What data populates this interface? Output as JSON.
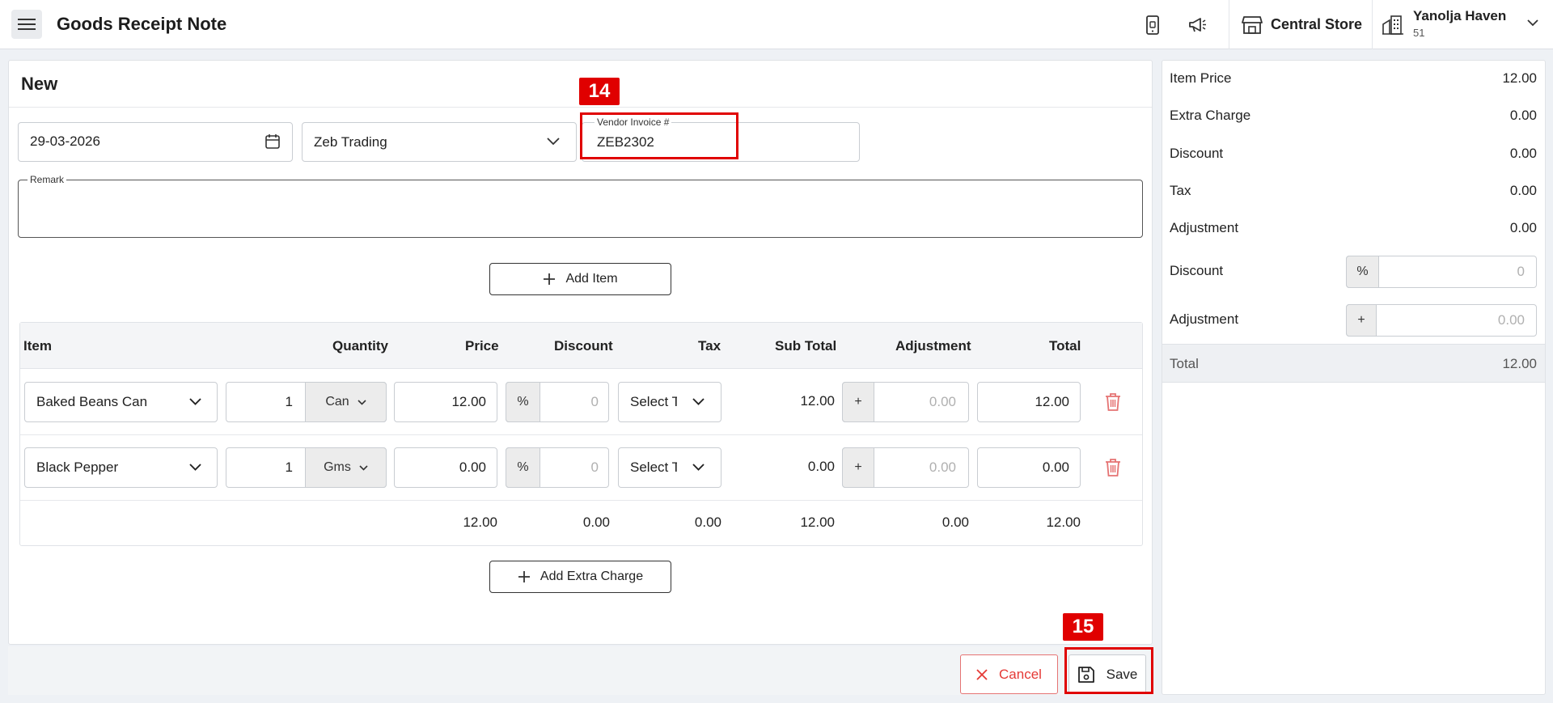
{
  "header": {
    "title": "Goods Receipt Note",
    "store_name": "Central Store",
    "property_name": "Yanolja Haven",
    "property_id": "51"
  },
  "form": {
    "card_title": "New",
    "date_value": "29-03-2026",
    "vendor_value": "Zeb Trading",
    "vendor_invoice_label": "Vendor Invoice #",
    "vendor_invoice_value": "ZEB2302",
    "remark_label": "Remark",
    "remark_value": "",
    "add_item_label": "Add Item",
    "add_extra_charge_label": "Add Extra Charge"
  },
  "table": {
    "headers": {
      "item": "Item",
      "quantity": "Quantity",
      "price": "Price",
      "discount": "Discount",
      "tax": "Tax",
      "subtotal": "Sub Total",
      "adjustment": "Adjustment",
      "total": "Total"
    },
    "rows": [
      {
        "item": "Baked Beans Can",
        "qty": "1",
        "unit": "Can",
        "price": "12.00",
        "disc_type": "%",
        "disc_ph": "0",
        "tax": "Select T",
        "subtotal": "12.00",
        "adj_sign": "+",
        "adj_ph": "0.00",
        "total": "12.00"
      },
      {
        "item": "Black Pepper",
        "qty": "1",
        "unit": "Gms",
        "price": "0.00",
        "disc_type": "%",
        "disc_ph": "0",
        "tax": "Select T",
        "subtotal": "0.00",
        "adj_sign": "+",
        "adj_ph": "0.00",
        "total": "0.00"
      }
    ],
    "totals": {
      "price": "12.00",
      "discount": "0.00",
      "tax": "0.00",
      "subtotal": "12.00",
      "adjustment": "0.00",
      "total": "12.00"
    }
  },
  "summary": {
    "item_price_label": "Item Price",
    "item_price": "12.00",
    "extra_charge_label": "Extra Charge",
    "extra_charge": "0.00",
    "discount_label": "Discount",
    "discount": "0.00",
    "tax_label": "Tax",
    "tax": "0.00",
    "adjustment_label": "Adjustment",
    "adjustment": "0.00",
    "discount_input_label": "Discount",
    "discount_input_prefix": "%",
    "discount_input_ph": "0",
    "adjustment_input_label": "Adjustment",
    "adjustment_input_prefix": "+",
    "adjustment_input_ph": "0.00",
    "total_label": "Total",
    "total": "12.00"
  },
  "footer": {
    "cancel_label": "Cancel",
    "save_label": "Save"
  },
  "annotations": {
    "badge_14": "14",
    "badge_15": "15"
  },
  "colors": {
    "accent_red": "#e00000",
    "cancel_red": "#e53935",
    "delete_red": "#e57373"
  }
}
